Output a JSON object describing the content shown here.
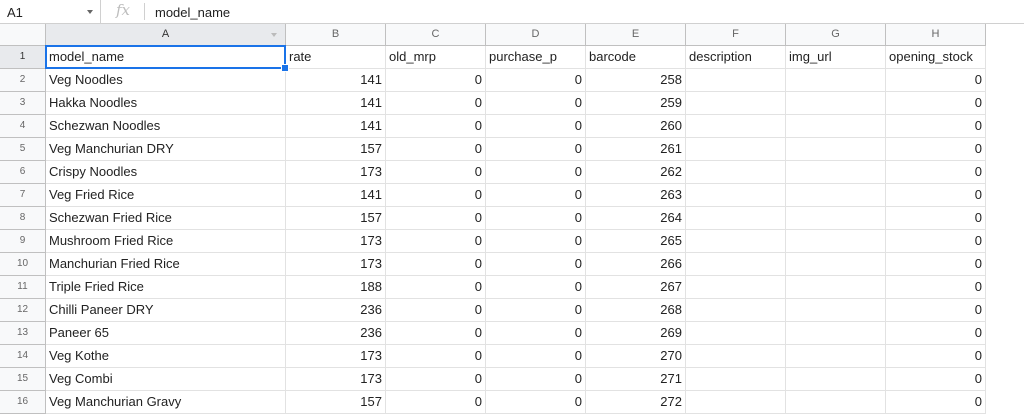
{
  "formula_bar": {
    "name_box": "A1",
    "fx_label": "fx",
    "formula_value": "model_name"
  },
  "columns": [
    "A",
    "B",
    "C",
    "D",
    "E",
    "F",
    "G",
    "H"
  ],
  "row_numbers": [
    "1",
    "2",
    "3",
    "4",
    "5",
    "6",
    "7",
    "8",
    "9",
    "10",
    "11",
    "12",
    "13",
    "14",
    "15",
    "16"
  ],
  "header_row": [
    "model_name",
    "rate",
    "old_mrp",
    "purchase_p",
    "barcode",
    "description",
    "img_url",
    "opening_stock"
  ],
  "rows": [
    [
      "Veg Noodles",
      "141",
      "0",
      "0",
      "258",
      "",
      "",
      "0"
    ],
    [
      "Hakka Noodles",
      "141",
      "0",
      "0",
      "259",
      "",
      "",
      "0"
    ],
    [
      "Schezwan Noodles",
      "141",
      "0",
      "0",
      "260",
      "",
      "",
      "0"
    ],
    [
      "Veg Manchurian DRY",
      "157",
      "0",
      "0",
      "261",
      "",
      "",
      "0"
    ],
    [
      "Crispy Noodles",
      "173",
      "0",
      "0",
      "262",
      "",
      "",
      "0"
    ],
    [
      "Veg Fried Rice",
      "141",
      "0",
      "0",
      "263",
      "",
      "",
      "0"
    ],
    [
      "Schezwan Fried Rice",
      "157",
      "0",
      "0",
      "264",
      "",
      "",
      "0"
    ],
    [
      "Mushroom Fried Rice",
      "173",
      "0",
      "0",
      "265",
      "",
      "",
      "0"
    ],
    [
      "Manchurian Fried Rice",
      "173",
      "0",
      "0",
      "266",
      "",
      "",
      "0"
    ],
    [
      "Triple Fried Rice",
      "188",
      "0",
      "0",
      "267",
      "",
      "",
      "0"
    ],
    [
      "Chilli Paneer DRY",
      "236",
      "0",
      "0",
      "268",
      "",
      "",
      "0"
    ],
    [
      "Paneer 65",
      "236",
      "0",
      "0",
      "269",
      "",
      "",
      "0"
    ],
    [
      "Veg Kothe",
      "173",
      "0",
      "0",
      "270",
      "",
      "",
      "0"
    ],
    [
      "Veg Combi",
      "173",
      "0",
      "0",
      "271",
      "",
      "",
      "0"
    ],
    [
      "Veg Manchurian Gravy",
      "157",
      "0",
      "0",
      "272",
      "",
      "",
      "0"
    ]
  ],
  "numeric_columns": [
    1,
    2,
    3,
    4,
    7
  ],
  "active_cell": {
    "column": "A",
    "row": "1"
  },
  "colors": {
    "selection": "#1a73e8",
    "header_bg": "#f8f9fa",
    "gridline": "#e2e2e2"
  }
}
